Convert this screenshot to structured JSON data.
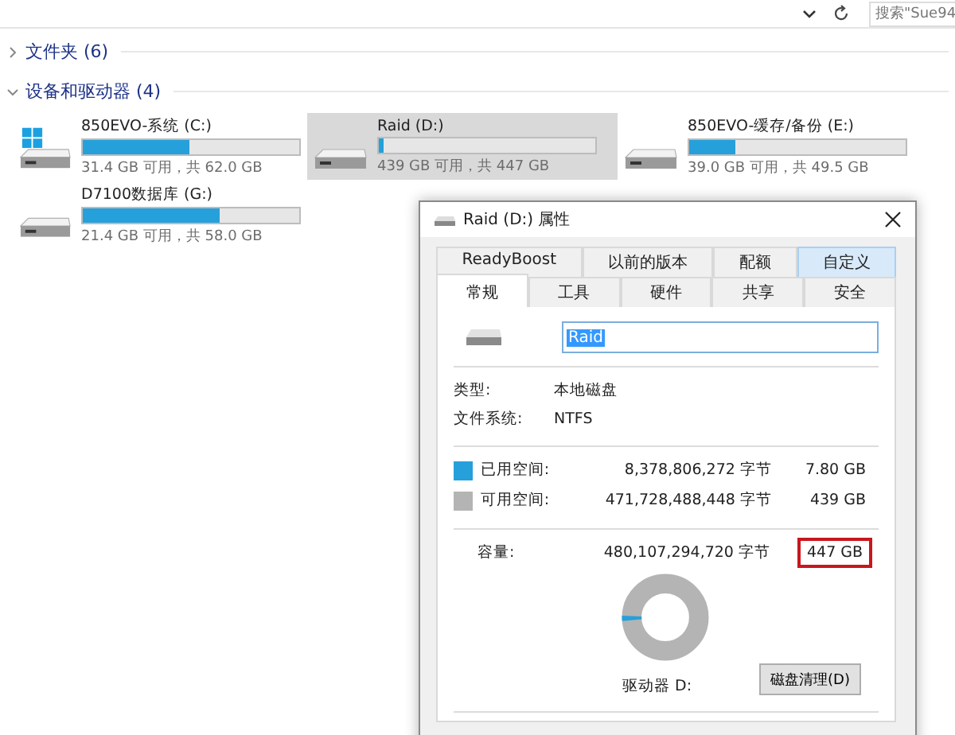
{
  "toolbar": {
    "search": {
      "placeholder": "搜索\"Sue94"
    }
  },
  "sections": [
    {
      "title": "文件夹 (6)",
      "expanded": false
    },
    {
      "title": "设备和驱动器 (4)",
      "expanded": true
    }
  ],
  "drives": [
    {
      "name": "850EVO-系统 (C:)",
      "level": 0.49,
      "info": "31.4 GB 可用，共 62.0 GB",
      "kind": "system",
      "selected": false
    },
    {
      "name": "Raid (D:)",
      "level": 0.02,
      "info": "439 GB 可用，共 447 GB",
      "kind": "disk",
      "selected": true
    },
    {
      "name": "850EVO-缓存/备份 (E:)",
      "level": 0.21,
      "info": "39.0 GB 可用，共 49.5 GB",
      "kind": "disk",
      "selected": false
    },
    {
      "name": "D7100数据库 (G:)",
      "level": 0.63,
      "info": "21.4 GB 可用，共 58.0 GB",
      "kind": "disk",
      "selected": false
    }
  ],
  "dialog": {
    "title": "Raid (D:) 属性",
    "tab_rows": [
      [
        {
          "label": "ReadyBoost",
          "selected": false,
          "hovered": false
        },
        {
          "label": "以前的版本",
          "selected": false,
          "hovered": false
        },
        {
          "label": "配额",
          "selected": false,
          "hovered": false
        },
        {
          "label": "自定义",
          "selected": false,
          "hovered": true
        }
      ],
      [
        {
          "label": "常规",
          "selected": true,
          "hovered": false
        },
        {
          "label": "工具",
          "selected": false,
          "hovered": false
        },
        {
          "label": "硬件",
          "selected": false,
          "hovered": false
        },
        {
          "label": "共享",
          "selected": false,
          "hovered": false
        },
        {
          "label": "安全",
          "selected": false,
          "hovered": false
        }
      ]
    ],
    "name_value": "Raid",
    "properties": [
      {
        "label": "类型:",
        "value": "本地磁盘"
      },
      {
        "label": "文件系统:",
        "value": "NTFS"
      }
    ],
    "space": [
      {
        "label": "已用空间:",
        "bytes": "8,378,806,272 字节",
        "size": "7.80 GB",
        "color": "#26a0da"
      },
      {
        "label": "可用空间:",
        "bytes": "471,728,488,448 字节",
        "size": "439 GB",
        "color": "#b4b4b4"
      }
    ],
    "capacity": {
      "label": "容量:",
      "bytes": "480,107,294,720 字节",
      "size": "447 GB",
      "highlighted": true
    },
    "usage_donut": {
      "level": 0.02
    },
    "drive_label": "驱动器 D:",
    "cleanup_button": "磁盘清理(D)"
  }
}
